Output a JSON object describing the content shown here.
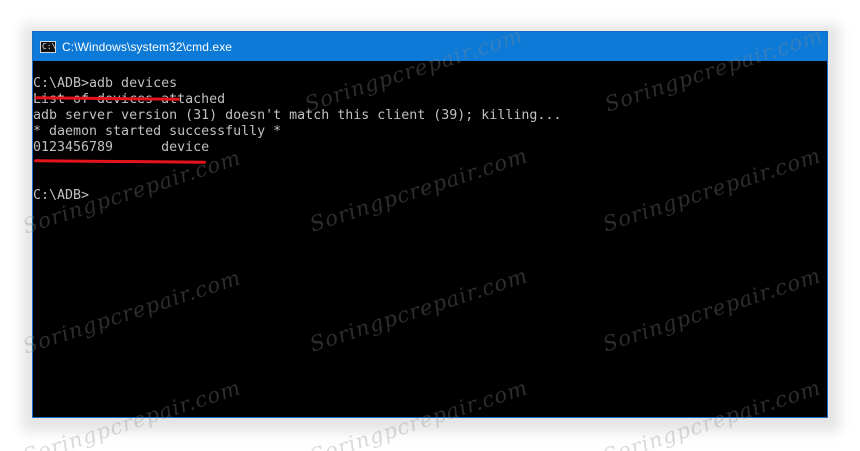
{
  "window": {
    "title": "C:\\Windows\\system32\\cmd.exe",
    "icon": "cmd-console-icon",
    "titlebar_color": "#0c7ad6",
    "background_color": "#000000"
  },
  "console": {
    "lines": [
      "C:\\ADB>adb devices",
      "List of devices attached",
      "adb server version (31) doesn't match this client (39); killing...",
      "* daemon started successfully *",
      "0123456789      device",
      "",
      "",
      "C:\\ADB>"
    ],
    "text_color": "#c0c0c0"
  },
  "annotations": {
    "underline_color": "#e5141b"
  },
  "watermark": {
    "text": "Soringpcrepair.com"
  }
}
